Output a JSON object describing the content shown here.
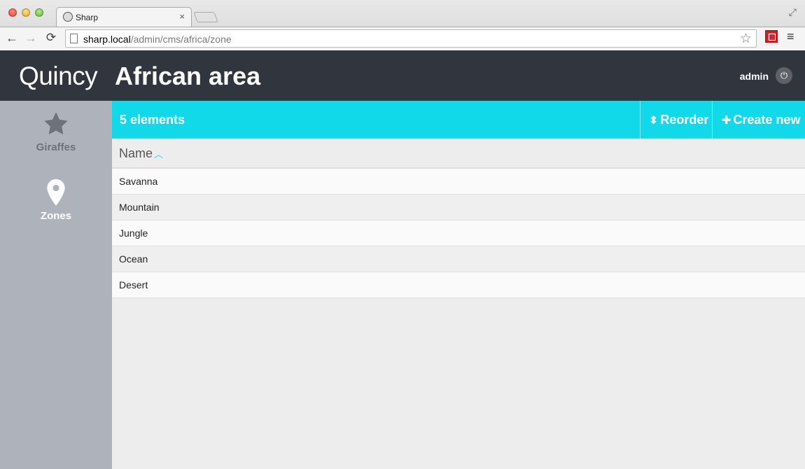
{
  "browser": {
    "tab_title": "Sharp",
    "tab_close": "×",
    "url_host": "sharp.local",
    "url_path": "/admin/cms/africa/zone"
  },
  "header": {
    "brand": "Quincy",
    "title": "African area",
    "user": "admin"
  },
  "sidebar": {
    "items": [
      {
        "label": "Giraffes",
        "icon": "star-icon",
        "active": false
      },
      {
        "label": "Zones",
        "icon": "map-marker-icon",
        "active": true
      }
    ]
  },
  "toolbar": {
    "count_label": "5 elements",
    "reorder_label": "Reorder",
    "create_label": "Create new"
  },
  "list": {
    "column": "Name",
    "sort": "ascending",
    "rows": [
      {
        "name": "Savanna"
      },
      {
        "name": "Mountain"
      },
      {
        "name": "Jungle"
      },
      {
        "name": "Ocean"
      },
      {
        "name": "Desert"
      }
    ]
  },
  "colors": {
    "accent": "#12d9ea",
    "header_bg": "#31353d",
    "sidebar_bg": "#adb2bb"
  }
}
